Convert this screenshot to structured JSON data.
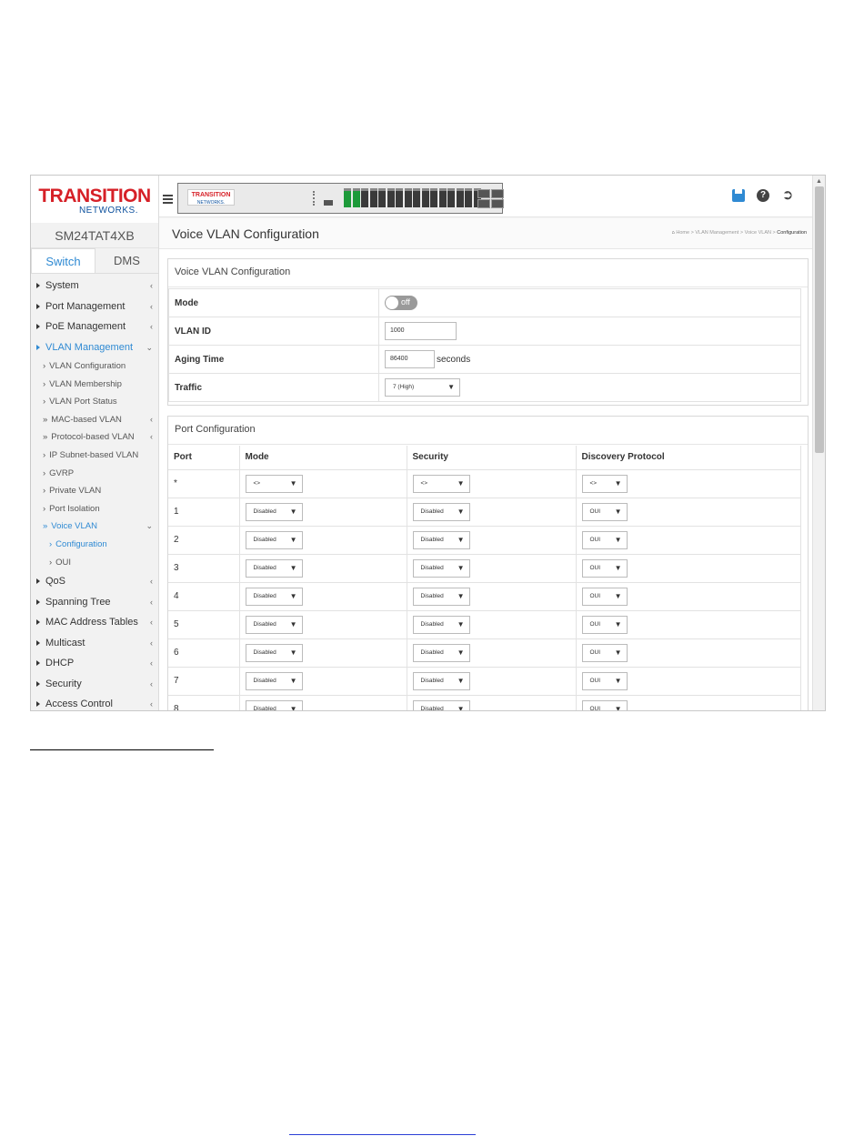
{
  "logo": {
    "line1": "TRANSITION",
    "line2": "NETWORKS."
  },
  "device_name": "SM24TAT4XB",
  "sidebar_tabs": [
    "Switch",
    "DMS"
  ],
  "nav": {
    "system": "System",
    "port_management": "Port Management",
    "poe_management": "PoE Management",
    "vlan_management": "VLAN Management",
    "vlan_configuration": "VLAN Configuration",
    "vlan_membership": "VLAN Membership",
    "vlan_port_status": "VLAN Port Status",
    "mac_based_vlan": "MAC-based VLAN",
    "protocol_based_vlan": "Protocol-based VLAN",
    "ip_subnet_based_vlan": "IP Subnet-based VLAN",
    "gvrp": "GVRP",
    "private_vlan": "Private VLAN",
    "port_isolation": "Port Isolation",
    "voice_vlan": "Voice VLAN",
    "configuration": "Configuration",
    "oui": "OUI",
    "qos": "QoS",
    "spanning_tree": "Spanning Tree",
    "mac_address_tables": "MAC Address Tables",
    "multicast": "Multicast",
    "dhcp": "DHCP",
    "security": "Security",
    "access_control": "Access Control"
  },
  "header": {
    "mini_logo": "TRANSITION",
    "mini_logo_sub": "NETWORKS."
  },
  "page": {
    "title": "Voice VLAN Configuration",
    "breadcrumb": [
      "Home",
      "VLAN Management",
      "Voice VLAN",
      "Configuration"
    ]
  },
  "voice_cfg": {
    "section_title": "Voice VLAN Configuration",
    "mode_label": "Mode",
    "mode_value": "off",
    "vlan_id_label": "VLAN ID",
    "vlan_id_value": "1000",
    "aging_label": "Aging Time",
    "aging_value": "86400",
    "aging_unit": "seconds",
    "traffic_label": "Traffic",
    "traffic_value": "7 (High)"
  },
  "port_cfg": {
    "section_title": "Port Configuration",
    "headers": [
      "Port",
      "Mode",
      "Security",
      "Discovery Protocol"
    ],
    "rows": [
      {
        "port": "*",
        "mode": "<>",
        "security": "<>",
        "discovery": "<>"
      },
      {
        "port": "1",
        "mode": "Disabled",
        "security": "Disabled",
        "discovery": "OUI"
      },
      {
        "port": "2",
        "mode": "Disabled",
        "security": "Disabled",
        "discovery": "OUI"
      },
      {
        "port": "3",
        "mode": "Disabled",
        "security": "Disabled",
        "discovery": "OUI"
      },
      {
        "port": "4",
        "mode": "Disabled",
        "security": "Disabled",
        "discovery": "OUI"
      },
      {
        "port": "5",
        "mode": "Disabled",
        "security": "Disabled",
        "discovery": "OUI"
      },
      {
        "port": "6",
        "mode": "Disabled",
        "security": "Disabled",
        "discovery": "OUI"
      },
      {
        "port": "7",
        "mode": "Disabled",
        "security": "Disabled",
        "discovery": "OUI"
      },
      {
        "port": "8",
        "mode": "Disabled",
        "security": "Disabled",
        "discovery": "OUI"
      }
    ]
  },
  "colors": {
    "accent": "#2f8ad3",
    "brand_red": "#d62027",
    "brand_blue": "#0b4f9c",
    "port_up": "#1d9a3a"
  },
  "icons": [
    "hamburger-icon",
    "save-icon",
    "help-icon",
    "logout-icon",
    "home-icon",
    "chevron-left-icon",
    "chevron-down-icon",
    "caret-down-icon"
  ]
}
